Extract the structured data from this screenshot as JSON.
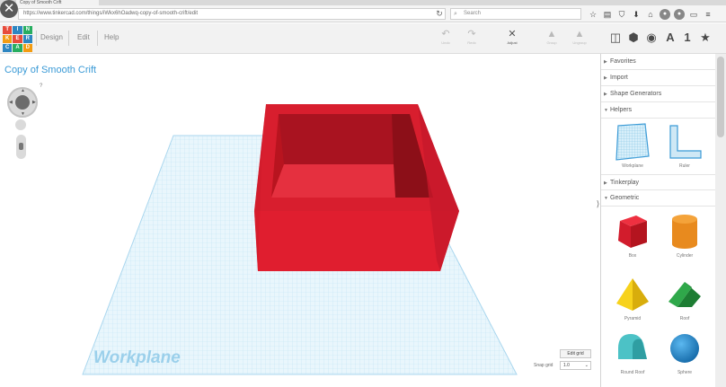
{
  "browser": {
    "tab_title": "Copy of Smooth Crift",
    "url": "https://www.tinkercad.com/things/iWkx6hOadwq-copy-of-smooth-crift/edit",
    "search_placeholder": "Search"
  },
  "app": {
    "logo_letters": [
      "T",
      "I",
      "N",
      "K",
      "E",
      "R",
      "C",
      "A",
      "D"
    ],
    "logo_colors": [
      "#e74c3c",
      "#2e86c1",
      "#27ae60",
      "#f39c12",
      "#e74c3c",
      "#2e86c1",
      "#2e86c1",
      "#27ae60",
      "#f39c12"
    ],
    "menu": [
      "Design",
      "Edit",
      "Help"
    ],
    "tools": {
      "undo": "Undo",
      "redo": "Redo",
      "adjust": "Adjust",
      "group": "Group",
      "ungroup": "Ungroup"
    },
    "view_text": "A",
    "view_number": "1"
  },
  "workspace": {
    "design_title": "Copy of Smooth Crift",
    "workplane_label": "Workplane",
    "edit_grid": "Edit grid",
    "snap_grid_label": "Snap grid",
    "snap_grid_value": "1.0"
  },
  "sidebar": {
    "categories": {
      "favorites": "Favorites",
      "import": "Import",
      "shape_generators": "Shape Generators",
      "helpers": "Helpers",
      "tinkerplay": "Tinkerplay",
      "geometric": "Geometric"
    },
    "helpers": [
      "Workplane",
      "Ruler"
    ],
    "geometric": [
      "Box",
      "Cylinder",
      "Pyramid",
      "Roof",
      "Round Roof",
      "Sphere"
    ]
  },
  "colors": {
    "accent": "#3a9ad6",
    "box_red": "#e01e2f",
    "grid": "#bfe3f3"
  }
}
